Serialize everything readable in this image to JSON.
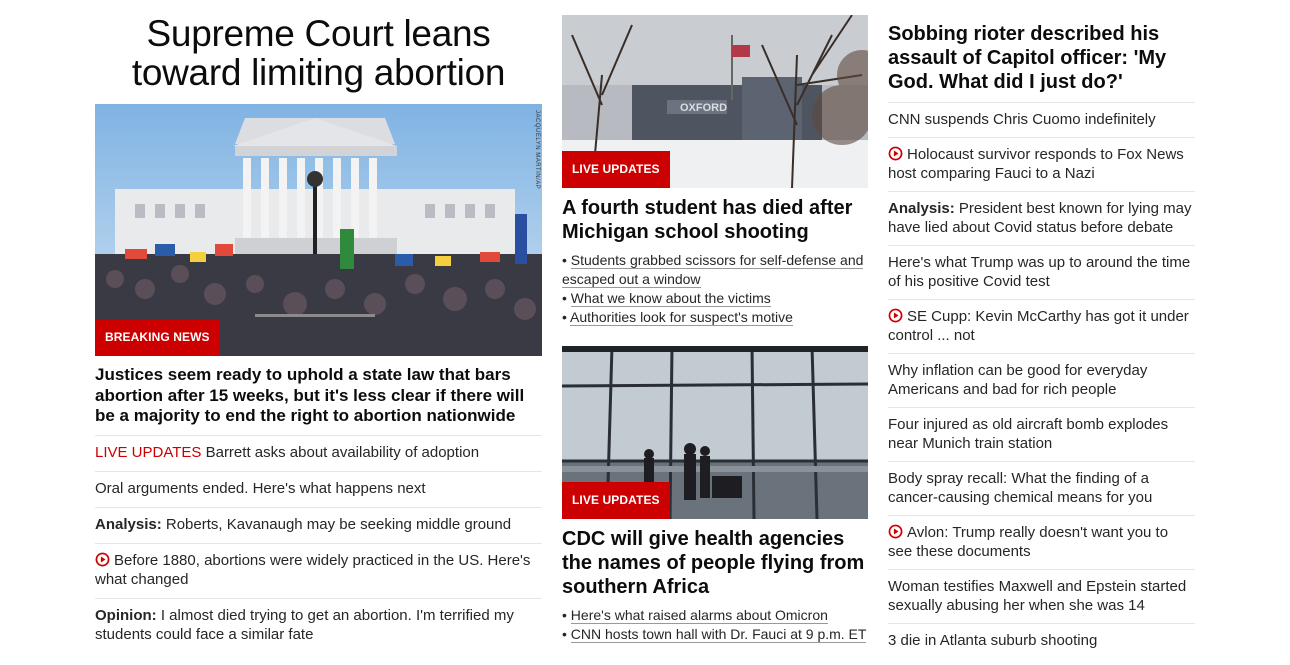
{
  "main": {
    "headline": "Supreme Court leans toward limiting abortion",
    "image_tag": "BREAKING NEWS",
    "photo_credit": "JACQUELYN MARTIN/AP",
    "subheadline": "Justices seem ready to uphold a state law that bars abortion after 15 weeks, but it's less clear if there will be a majority to end the right to abortion nationwide",
    "items": [
      {
        "prefix": "LIVE UPDATES",
        "text": "Barrett asks about availability of adoption"
      },
      {
        "prefix": "",
        "text": "Oral arguments ended. Here's what happens next"
      },
      {
        "prefix": "Analysis:",
        "text": "Roberts, Kavanaugh may be seeking middle ground"
      },
      {
        "prefix": "",
        "text": "Before 1880, abortions were widely practiced in the US. Here's what changed"
      },
      {
        "prefix": "Opinion:",
        "text": "I almost died trying to get an abortion. I'm terrified my students could face a similar fate"
      }
    ]
  },
  "middle": {
    "story1": {
      "tag": "LIVE UPDATES",
      "sign_text": "OXFORD",
      "title": "A fourth student has died after Michigan school shooting",
      "bullets": [
        "Students grabbed scissors for self-defense and escaped out a window",
        "What we know about the victims",
        "Authorities look for suspect's motive"
      ]
    },
    "story2": {
      "tag": "LIVE UPDATES",
      "title": "CDC will give health agencies the names of people flying from southern Africa",
      "bullets": [
        "Here's what raised alarms about Omicron",
        "CNN hosts town hall with Dr. Fauci at 9 p.m. ET"
      ]
    }
  },
  "side": {
    "headline": "Sobbing rioter described his assault of Capitol officer: 'My God. What did I just do?'",
    "items": [
      {
        "prefix": "",
        "text": "CNN suspends Chris Cuomo indefinitely"
      },
      {
        "prefix": "",
        "text": "Holocaust survivor responds to Fox News host comparing Fauci to a Nazi"
      },
      {
        "prefix": "Analysis:",
        "text": "President best known for lying may have lied about Covid status before debate"
      },
      {
        "prefix": "",
        "text": "Here's what Trump was up to around the time of his positive Covid test"
      },
      {
        "prefix": "",
        "text": "SE Cupp: Kevin McCarthy has got it under control ... not"
      },
      {
        "prefix": "",
        "text": "Why inflation can be good for everyday Americans and bad for rich people"
      },
      {
        "prefix": "",
        "text": "Four injured as old aircraft bomb explodes near Munich train station"
      },
      {
        "prefix": "",
        "text": "Body spray recall: What the finding of a cancer-causing chemical means for you"
      },
      {
        "prefix": "",
        "text": "Avlon: Trump really doesn't want you to see these documents"
      },
      {
        "prefix": "",
        "text": "Woman testifies Maxwell and Epstein started sexually abusing her when she was 14"
      },
      {
        "prefix": "",
        "text": "3 die in Atlanta suburb shooting"
      }
    ]
  },
  "colors": {
    "accent": "#cc0000",
    "text": "#262626",
    "divider": "#e6e6e6"
  },
  "icons": {
    "video": "play-circle-icon"
  }
}
